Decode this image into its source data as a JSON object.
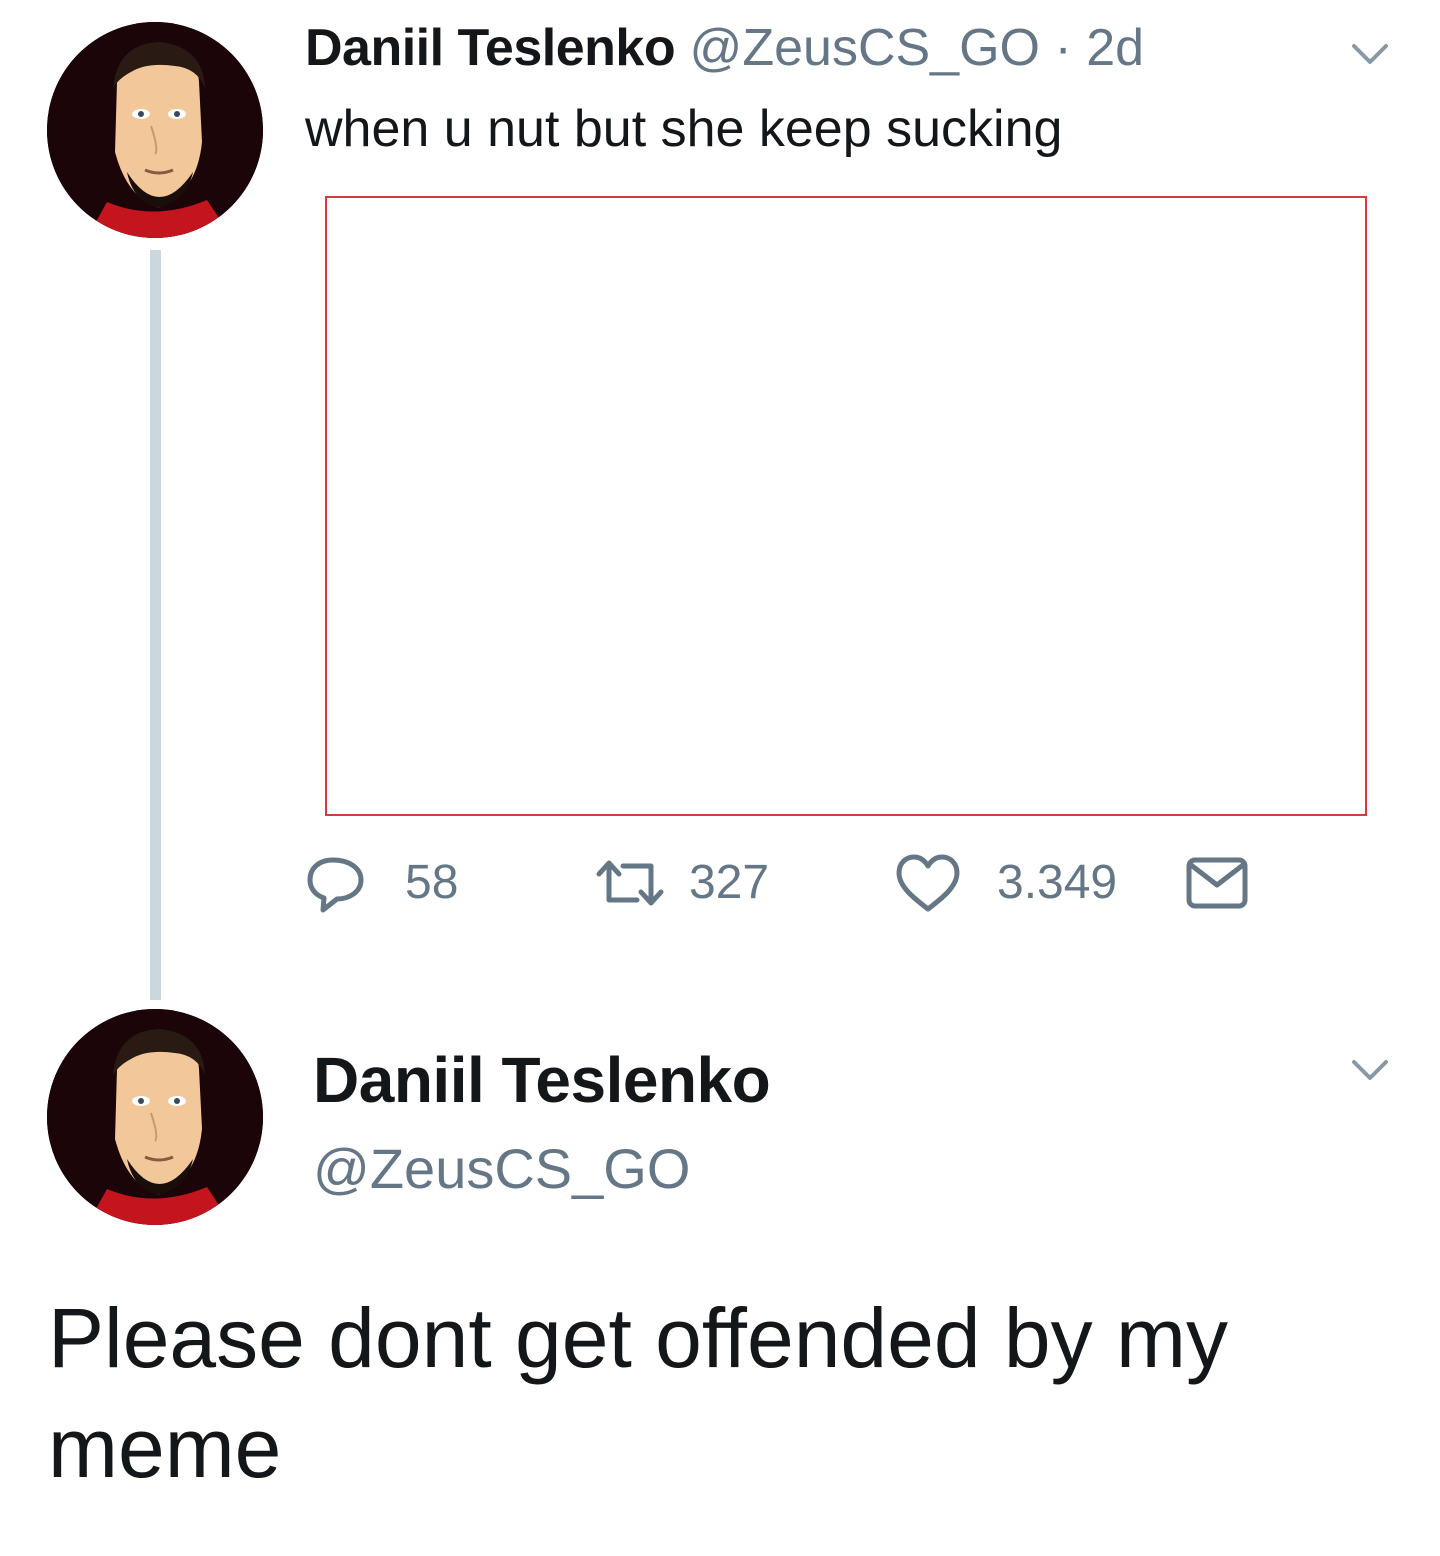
{
  "tweet": {
    "author_name": "Daniil Teslenko",
    "author_handle": "@ZeusCS_GO",
    "separator": "·",
    "time": "2d",
    "text": "when u nut but she keep sucking",
    "avatar_icon": "cartoon-portrait",
    "actions": {
      "reply_count": "58",
      "retweet_count": "327",
      "like_count": "3.349"
    }
  },
  "reply": {
    "author_name": "Daniil Teslenko",
    "author_handle": "@ZeusCS_GO",
    "text": "Please dont get offended by my meme",
    "avatar_icon": "cartoon-portrait"
  },
  "colors": {
    "text_primary": "#14171a",
    "text_secondary": "#657786",
    "thread_line": "#ccd6dd",
    "media_border": "#d9383f"
  }
}
